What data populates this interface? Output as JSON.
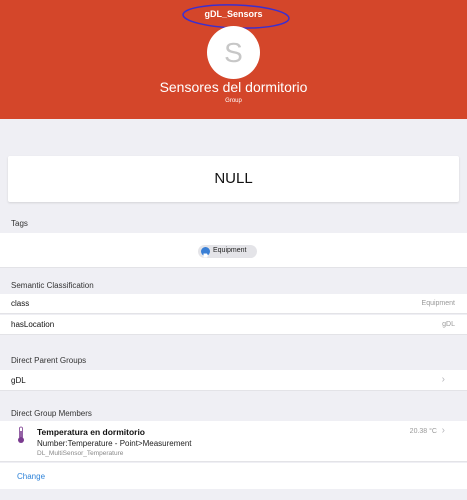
{
  "header": {
    "title": "gDL_Sensors",
    "avatar_letter": "S",
    "group_name": "Sensores del dormitorio",
    "group_type": "Group",
    "bg_color": "#d4462a",
    "annotation_color": "#3b2fd0"
  },
  "state": {
    "value": "NULL"
  },
  "tags": {
    "label": "Tags",
    "chip_label": "Equipment",
    "chip_icon": "tag-icon"
  },
  "semantic": {
    "label": "Semantic Classification",
    "rows": [
      {
        "key": "class",
        "value": "Equipment"
      },
      {
        "key": "hasLocation",
        "value": "gDL"
      }
    ]
  },
  "parents": {
    "label": "Direct Parent Groups",
    "items": [
      {
        "name": "gDL"
      }
    ]
  },
  "members": {
    "label": "Direct Group Members",
    "items": [
      {
        "title": "Temperatura en dormitorio",
        "type": "Number:Temperature - Point>Measurement",
        "name": "DL_MultiSensor_Temperature",
        "value": "20.38 °C",
        "icon": "thermometer-icon"
      }
    ],
    "change_label": "Change"
  }
}
